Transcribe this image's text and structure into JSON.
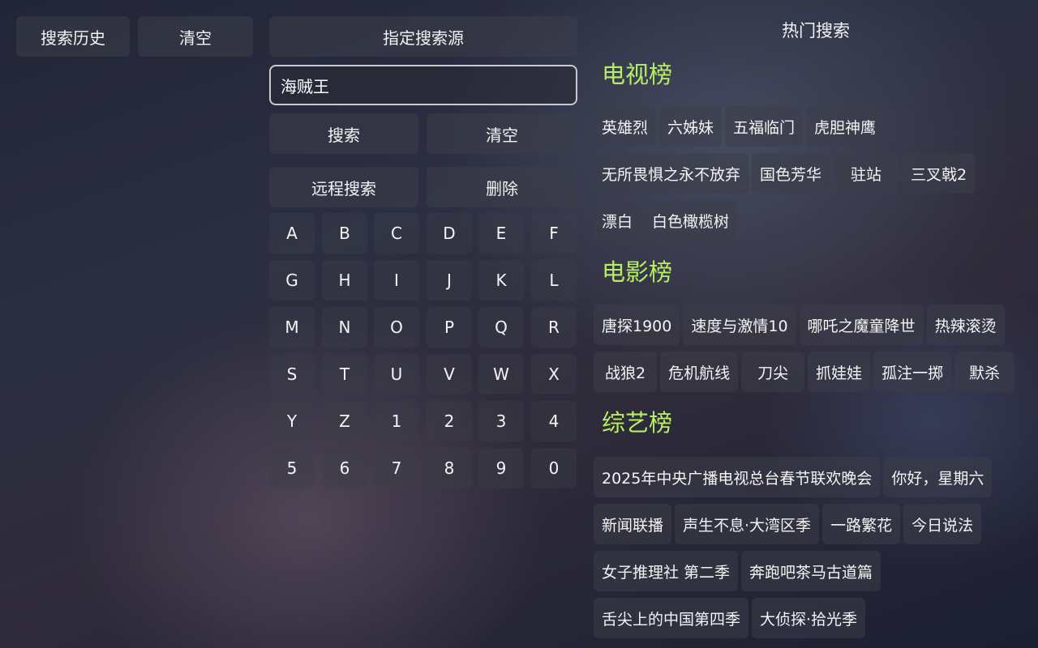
{
  "history": {
    "title_label": "搜索历史",
    "clear_label": "清空"
  },
  "source_button_label": "指定搜索源",
  "search": {
    "value": "海贼王",
    "search_label": "搜索",
    "clear_label": "清空",
    "remote_label": "远程搜索",
    "delete_label": "删除"
  },
  "keyboard": {
    "rows": [
      [
        "A",
        "B",
        "C",
        "D",
        "E",
        "F"
      ],
      [
        "G",
        "H",
        "I",
        "J",
        "K",
        "L"
      ],
      [
        "M",
        "N",
        "O",
        "P",
        "Q",
        "R"
      ],
      [
        "S",
        "T",
        "U",
        "V",
        "W",
        "X"
      ],
      [
        "Y",
        "Z",
        "1",
        "2",
        "3",
        "4"
      ],
      [
        "5",
        "6",
        "7",
        "8",
        "9",
        "0"
      ]
    ]
  },
  "hot": {
    "title": "热门搜索",
    "heading_color": "#b6ef62",
    "categories": [
      {
        "name": "电视榜",
        "rows": [
          [
            "英雄烈",
            "六姊妹",
            "五福临门",
            "虎胆神鹰"
          ],
          [
            "无所畏惧之永不放弃",
            "国色芳华",
            "驻站",
            "三叉戟2"
          ],
          [
            "漂白",
            "白色橄榄树"
          ]
        ]
      },
      {
        "name": "电影榜",
        "rows": [
          [
            "唐探1900",
            "速度与激情10",
            "哪吒之魔童降世",
            "热辣滚烫"
          ],
          [
            "战狼2",
            "危机航线",
            "刀尖",
            "抓娃娃",
            "孤注一掷",
            "默杀"
          ]
        ]
      },
      {
        "name": "综艺榜",
        "rows": [
          [
            "2025年中央广播电视总台春节联欢晚会",
            "你好，星期六"
          ],
          [
            "新闻联播",
            "声生不息·大湾区季",
            "一路繁花",
            "今日说法"
          ],
          [
            "女子推理社 第二季",
            "奔跑吧茶马古道篇"
          ],
          [
            "舌尖上的中国第四季",
            "大侦探·拾光季"
          ]
        ]
      }
    ]
  }
}
